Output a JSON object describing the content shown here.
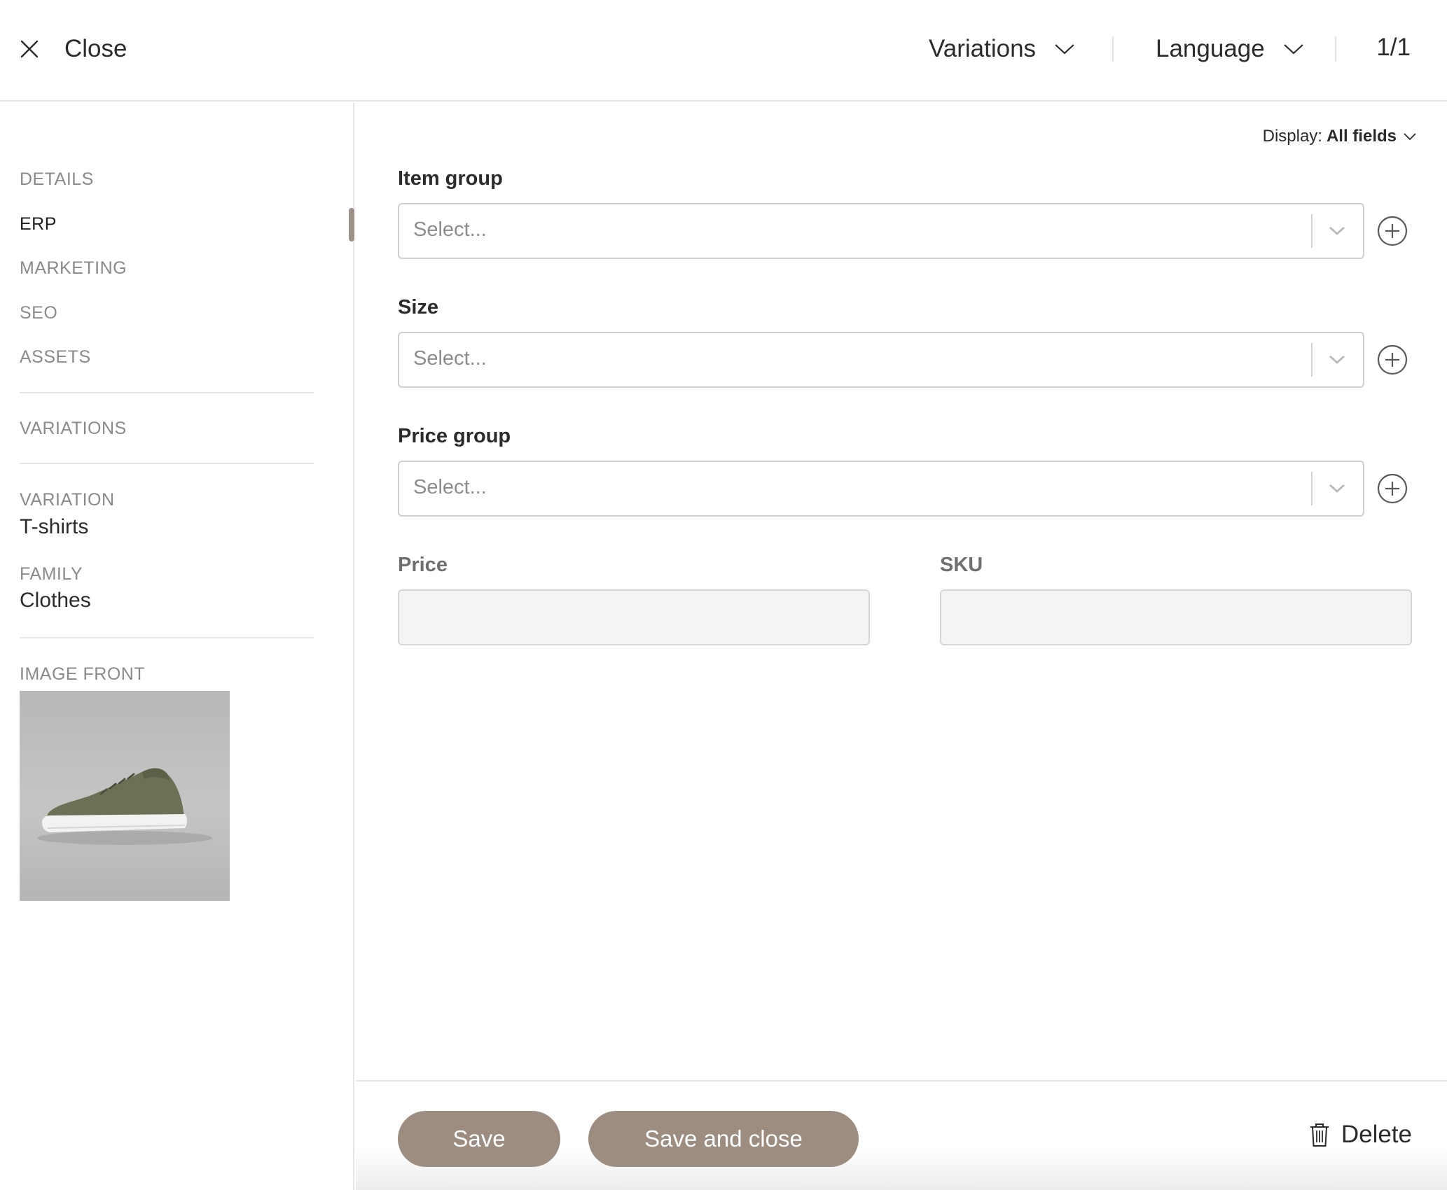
{
  "header": {
    "close_label": "Close",
    "variations_label": "Variations",
    "language_label": "Language",
    "pager": "1/1"
  },
  "sidebar": {
    "nav": [
      {
        "label": "DETAILS",
        "active": false
      },
      {
        "label": "ERP",
        "active": true
      },
      {
        "label": "MARKETING",
        "active": false
      },
      {
        "label": "SEO",
        "active": false
      },
      {
        "label": "ASSETS",
        "active": false
      }
    ],
    "variations_label": "VARIATIONS",
    "variation": {
      "label": "VARIATION",
      "value": "T-shirts"
    },
    "family": {
      "label": "FAMILY",
      "value": "Clothes"
    },
    "image_label": "IMAGE FRONT"
  },
  "display": {
    "prefix": "Display:",
    "value": "All fields"
  },
  "form": {
    "item_group": {
      "label": "Item group",
      "placeholder": "Select..."
    },
    "size": {
      "label": "Size",
      "placeholder": "Select..."
    },
    "price_group": {
      "label": "Price group",
      "placeholder": "Select..."
    },
    "price": {
      "label": "Price",
      "value": ""
    },
    "sku": {
      "label": "SKU",
      "value": ""
    }
  },
  "footer": {
    "save_label": "Save",
    "save_close_label": "Save and close",
    "delete_label": "Delete"
  },
  "colors": {
    "accent": "#9d8d80",
    "border": "#cfcfcf",
    "muted_text": "#8a8a8a"
  },
  "icons": [
    "close-icon",
    "chevron-down-icon",
    "plus-circle-icon",
    "trash-icon"
  ]
}
